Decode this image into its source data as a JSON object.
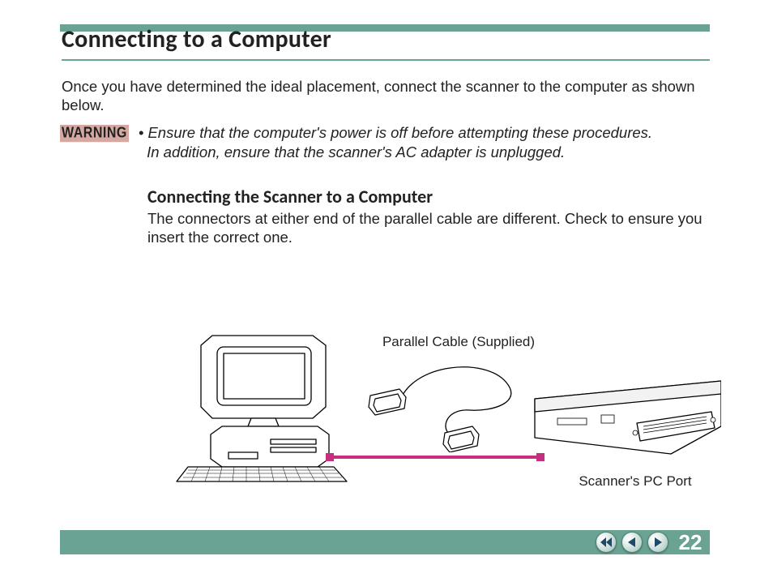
{
  "page_number": "22",
  "title": "Connecting to a Computer",
  "intro": "Once you have determined the ideal placement, connect the scanner to the computer as shown below.",
  "warning_label": "WARNING",
  "warning_text_line1": "• Ensure that the computer's power is off before attempting these procedures.",
  "warning_text_line2": "In addition, ensure that the scanner's AC adapter is unplugged.",
  "subheading": "Connecting the Scanner to a Computer",
  "subbody": "The connectors at either end of the parallel cable are different. Check to ensure you insert the correct one.",
  "label_cable": "Parallel Cable (Supplied)",
  "label_port": "Scanner's PC Port",
  "icons": {
    "fast_back": "fast-back-icon",
    "prev": "prev-page-icon",
    "next": "next-page-icon",
    "computer": "computer-illustration",
    "cable": "parallel-cable-illustration",
    "scanner": "scanner-port-illustration"
  },
  "colors": {
    "teal": "#6aa394",
    "magenta": "#c4307e",
    "warning_bg": "#d5a9a2"
  }
}
